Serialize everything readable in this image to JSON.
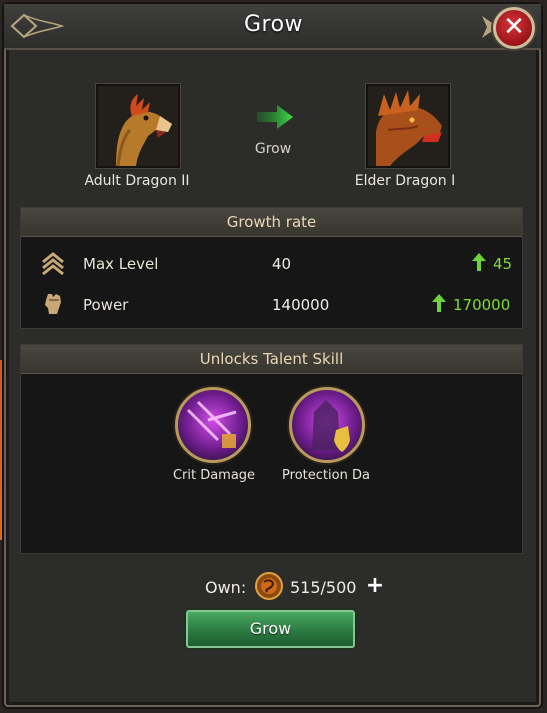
{
  "dialog": {
    "title": "Grow"
  },
  "upgrade": {
    "from_name": "Adult Dragon II",
    "to_name": "Elder Dragon I",
    "action_label": "Grow"
  },
  "growth": {
    "header": "Growth rate",
    "rows": [
      {
        "icon": "chevrons-up-icon",
        "label": "Max Level",
        "current": "40",
        "next": "45"
      },
      {
        "icon": "fist-icon",
        "label": "Power",
        "current": "140000",
        "next": "170000"
      }
    ]
  },
  "talents": {
    "header": "Unlocks Talent Skill",
    "skills": [
      {
        "icon": "crit-damage-skill-icon",
        "label": "Crit Damage"
      },
      {
        "icon": "protection-skill-icon",
        "label": "Protection Da"
      }
    ]
  },
  "resource": {
    "label": "Own:",
    "icon": "dragon-medal-icon",
    "count": "515/500"
  },
  "button": {
    "label": "Grow"
  },
  "colors": {
    "accent_green": "#7ddc3a",
    "button_green": "#2c7a42",
    "close_red": "#c0242a"
  }
}
